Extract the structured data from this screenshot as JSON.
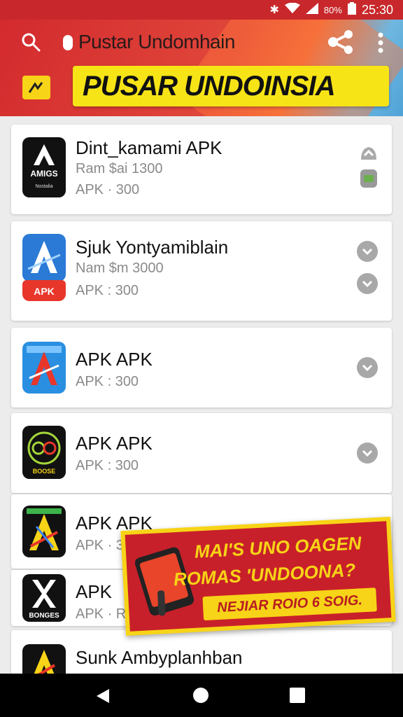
{
  "status_bar": {
    "battery": "80%",
    "time": "25:30"
  },
  "header": {
    "title": "Pustar Undomhain",
    "banner": "PUSAR UNDOINSIA"
  },
  "icons": {
    "search": "search-icon",
    "share": "share-icon",
    "more": "more-vert-icon",
    "download": "chevron-down-circle-icon"
  },
  "apps": [
    {
      "name": "Dint_kamami APK",
      "line1": "Ram $ai 1300",
      "line2": "APK · 300",
      "icon_text": "AMIGS",
      "icon_sub": "Nostalia"
    },
    {
      "name": "Sjuk Yontyamiblain",
      "line1": "Nam $m 3000",
      "line2": "APK : 300",
      "icon_text": "APK"
    },
    {
      "name": "APK APK",
      "line1": "APK : 300"
    },
    {
      "name": "APK APK",
      "line1": "APK : 300",
      "icon_text": "BOOSE"
    },
    {
      "name": "APK APK",
      "line1": "APK · 356"
    },
    {
      "name": "APK",
      "line1": "APK · R",
      "icon_text": "BONGES"
    },
    {
      "name": "Sunk Ambyplanhban",
      "line1": ""
    }
  ],
  "promo": {
    "line1": "MAI'S UNO OAGEN",
    "line2": "ROMAS 'UNDOONA?",
    "tag": "NEJIAR ROIO 6 SOIG."
  },
  "colors": {
    "header_red": "#d32a2e",
    "banner_yellow": "#f7e416",
    "promo_red": "#c8202a"
  }
}
